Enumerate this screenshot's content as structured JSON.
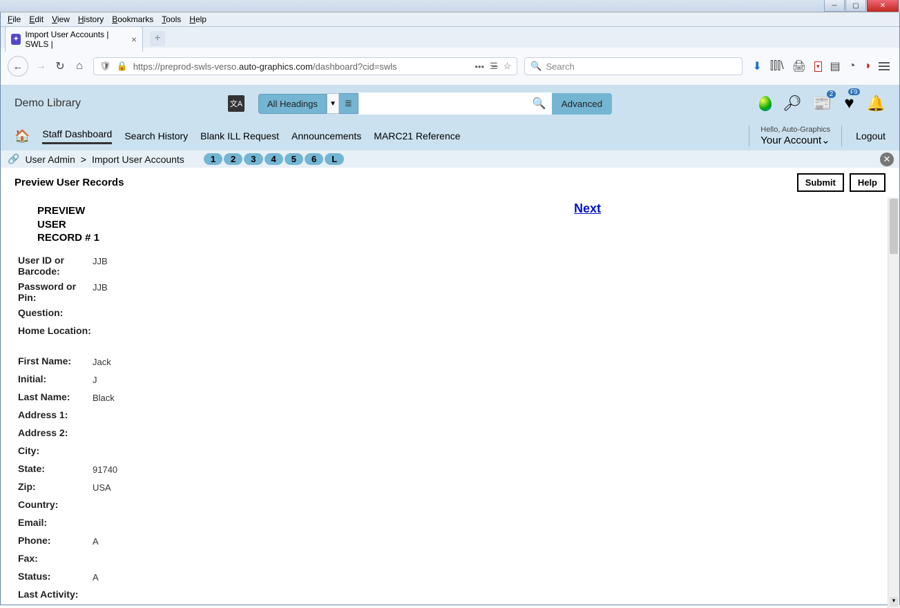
{
  "window": {
    "menu": [
      "File",
      "Edit",
      "View",
      "History",
      "Bookmarks",
      "Tools",
      "Help"
    ]
  },
  "browserTab": {
    "title": "Import User Accounts | SWLS |"
  },
  "addressBar": {
    "url_prefix": "https://",
    "url_host_grey": "preprod-swls-verso.",
    "url_host_dark": "auto-graphics.com",
    "url_path": "/dashboard?cid=swls",
    "search_placeholder": "Search"
  },
  "appHeader": {
    "library": "Demo Library",
    "headingsSelect": "All Headings",
    "advanced": "Advanced",
    "newsBadge": "2",
    "heartBadge": "F9"
  },
  "nav": {
    "items": [
      "Staff Dashboard",
      "Search History",
      "Blank ILL Request",
      "Announcements",
      "MARC21 Reference"
    ],
    "hello": "Hello, Auto-Graphics",
    "account": "Your Account",
    "logout": "Logout"
  },
  "breadcrumb": {
    "part1": "User Admin",
    "sep": ">",
    "part2": "Import User Accounts",
    "pager": [
      "1",
      "2",
      "3",
      "4",
      "5",
      "6",
      "L"
    ]
  },
  "page": {
    "title": "Preview User Records",
    "submit": "Submit",
    "help": "Help",
    "previewHeader": "PREVIEW USER RECORD # 1",
    "next": "Next"
  },
  "record": {
    "fields": [
      {
        "label": "User ID or Barcode:",
        "value": "JJB",
        "cls": "med"
      },
      {
        "label": "Password or Pin:",
        "value": "JJB",
        "cls": "med"
      },
      {
        "label": "Question:",
        "value": ""
      },
      {
        "label": "Home Location:",
        "value": "",
        "cls": "tall"
      },
      {
        "label": "First Name:",
        "value": "Jack"
      },
      {
        "label": "Initial:",
        "value": "J"
      },
      {
        "label": "Last Name:",
        "value": "Black"
      },
      {
        "label": "Address 1:",
        "value": ""
      },
      {
        "label": "Address 2:",
        "value": ""
      },
      {
        "label": "City:",
        "value": ""
      },
      {
        "label": "State:",
        "value": "91740"
      },
      {
        "label": "Zip:",
        "value": "USA"
      },
      {
        "label": "Country:",
        "value": ""
      },
      {
        "label": "Email:",
        "value": ""
      },
      {
        "label": "Phone:",
        "value": "A"
      },
      {
        "label": "Fax:",
        "value": ""
      },
      {
        "label": "Status:",
        "value": "A"
      },
      {
        "label": "Last Activity:",
        "value": ""
      }
    ]
  }
}
